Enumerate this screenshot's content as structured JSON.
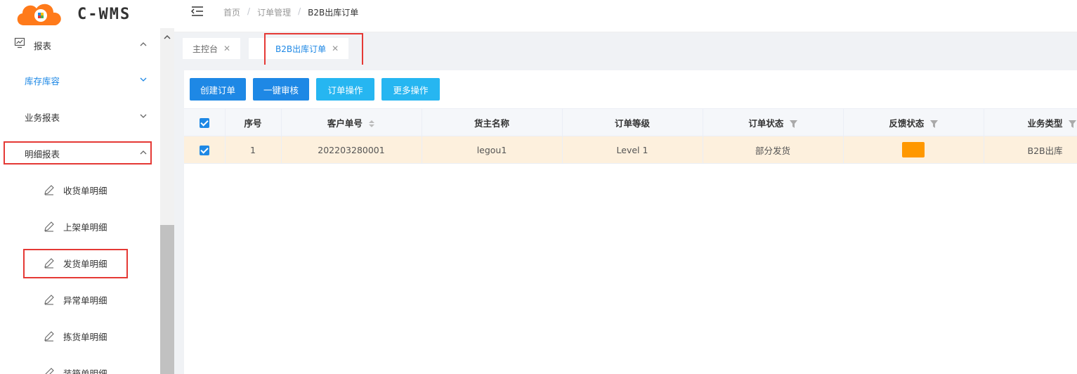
{
  "logo": {
    "text": "C-WMS"
  },
  "sidebar": {
    "items": [
      {
        "label": "报表",
        "level": 0,
        "icon": "chart-icon",
        "expanded": true
      },
      {
        "label": "库存库容",
        "level": 1,
        "active": true
      },
      {
        "label": "业务报表",
        "level": 1
      },
      {
        "label": "明细报表",
        "level": 1,
        "expanded": true
      },
      {
        "label": "收货单明细",
        "level": 2,
        "icon": "edit-icon"
      },
      {
        "label": "上架单明细",
        "level": 2,
        "icon": "edit-icon"
      },
      {
        "label": "发货单明细",
        "level": 2,
        "icon": "edit-icon"
      },
      {
        "label": "异常单明细",
        "level": 2,
        "icon": "edit-icon"
      },
      {
        "label": "拣货单明细",
        "level": 2,
        "icon": "edit-icon"
      },
      {
        "label": "装箱单明细",
        "level": 2,
        "icon": "edit-icon"
      }
    ]
  },
  "breadcrumb": {
    "home": "首页",
    "section": "订单管理",
    "current": "B2B出库订单",
    "sep": "/"
  },
  "tabs": [
    {
      "label": "主控台",
      "close": "✕"
    },
    {
      "label": "B2B出库订单",
      "close": "✕",
      "active": true
    }
  ],
  "toolbar": {
    "create_order": "创建订单",
    "one_click_review": "一键审核",
    "order_ops": "订单操作",
    "more_ops": "更多操作"
  },
  "table": {
    "headers": {
      "seq": "序号",
      "customer_no": "客户单号",
      "owner_name": "货主名称",
      "order_level": "订单等级",
      "order_status": "订单状态",
      "feedback_status": "反馈状态",
      "business_type": "业务类型"
    },
    "rows": [
      {
        "seq": "1",
        "customer_no": "202203280001",
        "owner_name": "legou1",
        "order_level": "Level 1",
        "order_status": "部分发货",
        "business_type": "B2B出库"
      }
    ]
  },
  "colors": {
    "primary": "#1e88e5",
    "info": "#26b6f1",
    "row_highlight": "#fdf0dd",
    "badge": "#ff9800",
    "highlight_box": "#e53935"
  }
}
